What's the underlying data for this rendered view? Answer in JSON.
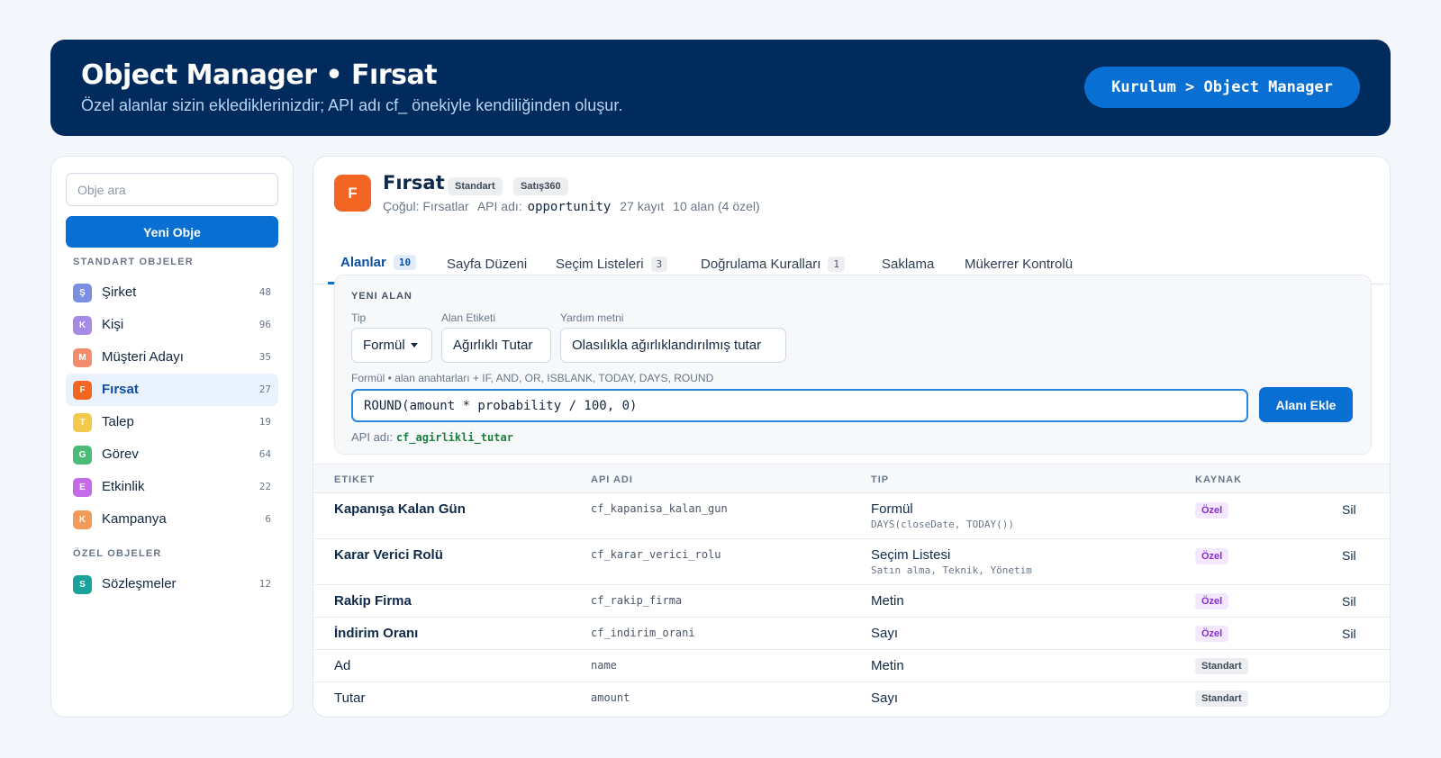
{
  "header": {
    "title": "Object Manager • Fırsat",
    "subtitle": "Özel alanlar sizin eklediklerinizdir; API adı cf_ önekiyle kendiliğinden oluşur.",
    "breadcrumb": "Kurulum > Object Manager"
  },
  "sidebar": {
    "search_placeholder": "Obje ara",
    "new_button": "Yeni Obje",
    "standard_section": "STANDART OBJELER",
    "custom_section": "ÖZEL OBJELER",
    "standard_items": [
      {
        "letter": "Ş",
        "label": "Şirket",
        "count": "48",
        "color": "#7b8ee0"
      },
      {
        "letter": "K",
        "label": "Kişi",
        "count": "96",
        "color": "#a78ae6"
      },
      {
        "letter": "M",
        "label": "Müşteri Adayı",
        "count": "35",
        "color": "#f28c6a"
      },
      {
        "letter": "F",
        "label": "Fırsat",
        "count": "27",
        "color": "#f26522"
      },
      {
        "letter": "T",
        "label": "Talep",
        "count": "19",
        "color": "#f2c94c"
      },
      {
        "letter": "G",
        "label": "Görev",
        "count": "64",
        "color": "#4cbb7a"
      },
      {
        "letter": "E",
        "label": "Etkinlik",
        "count": "22",
        "color": "#c56be8"
      },
      {
        "letter": "K",
        "label": "Kampanya",
        "count": "6",
        "color": "#f29a5a"
      }
    ],
    "custom_items": [
      {
        "letter": "S",
        "label": "Sözleşmeler",
        "count": "12",
        "color": "#1aa39a"
      }
    ]
  },
  "object": {
    "icon_letter": "F",
    "title": "Fırsat",
    "badges": [
      "Standart",
      "Satış360"
    ],
    "plural": "Çoğul: Fırsatlar",
    "api_label": "API adı:",
    "api_name": "opportunity",
    "records": "27 kayıt",
    "fields": "10 alan (4 özel)"
  },
  "tabs": [
    {
      "label": "Alanlar",
      "count": "10"
    },
    {
      "label": "Sayfa Düzeni",
      "count": ""
    },
    {
      "label": "Seçim Listeleri",
      "count": "3"
    },
    {
      "label": "Doğrulama Kuralları",
      "count": "1"
    },
    {
      "label": "Saklama",
      "count": ""
    },
    {
      "label": "Mükerrer Kontrolü",
      "count": ""
    }
  ],
  "new_field": {
    "heading": "YENI ALAN",
    "type_label": "Tip",
    "type_value": "Formül",
    "label_label": "Alan Etiketi",
    "label_value": "Ağırlıklı Tutar",
    "help_label": "Yardım metni",
    "help_value": "Olasılıkla ağırlıklandırılmış tutar",
    "formula_hint": "Formül • alan anahtarları + IF, AND, OR, ISBLANK, TODAY, DAYS, ROUND",
    "formula_value": "ROUND(amount * probability / 100, 0)",
    "add_button": "Alanı Ekle",
    "api_label": "API adı:",
    "api_value": "cf_agirlikli_tutar"
  },
  "table": {
    "columns": [
      "ETIKET",
      "API ADI",
      "TIP",
      "KAYNAK"
    ],
    "rows": [
      {
        "label": "Kapanışa Kalan Gün",
        "api": "cf_kapanisa_kalan_gun",
        "type": "Formül",
        "type_sub": "DAYS(closeDate, TODAY())",
        "source": "Özel",
        "delete": "Sil"
      },
      {
        "label": "Karar Verici Rolü",
        "api": "cf_karar_verici_rolu",
        "type": "Seçim Listesi",
        "type_sub": "Satın alma, Teknik, Yönetim",
        "source": "Özel",
        "delete": "Sil"
      },
      {
        "label": "Rakip Firma",
        "api": "cf_rakip_firma",
        "type": "Metin",
        "type_sub": "",
        "source": "Özel",
        "delete": "Sil"
      },
      {
        "label": "İndirim Oranı",
        "api": "cf_indirim_orani",
        "type": "Sayı",
        "type_sub": "",
        "source": "Özel",
        "delete": "Sil"
      },
      {
        "label": "Ad",
        "api": "name",
        "type": "Metin",
        "type_sub": "",
        "source": "Standart",
        "delete": ""
      },
      {
        "label": "Tutar",
        "api": "amount",
        "type": "Sayı",
        "type_sub": "",
        "source": "Standart",
        "delete": ""
      }
    ]
  }
}
